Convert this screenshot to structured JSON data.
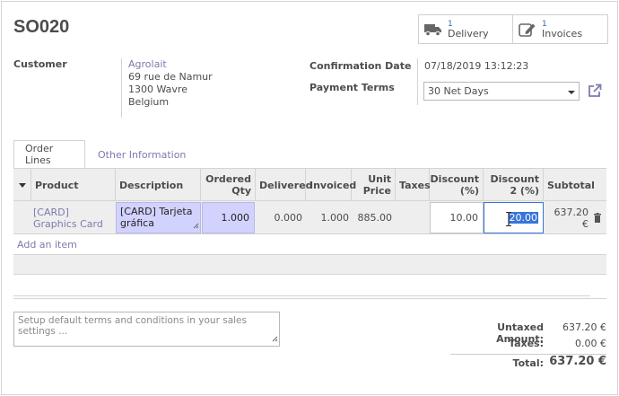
{
  "header": {
    "title": "SO020",
    "smart_buttons": [
      {
        "count": "1",
        "label": "Delivery",
        "icon": "truck-icon"
      },
      {
        "count": "1",
        "label": "Invoices",
        "icon": "pencil-square-icon"
      }
    ]
  },
  "customer": {
    "label": "Customer",
    "name": "Agrolait",
    "address_line1": "69 rue de Namur",
    "address_line2": "1300 Wavre",
    "country": "Belgium"
  },
  "confirmation": {
    "label": "Confirmation Date",
    "value": "07/18/2019 13:12:23"
  },
  "payment_terms": {
    "label": "Payment Terms",
    "value": "30 Net Days"
  },
  "tabs": [
    {
      "label": "Order Lines"
    },
    {
      "label": "Other Information"
    }
  ],
  "table": {
    "columns": {
      "product": "Product",
      "description": "Description",
      "ordered_qty": "Ordered Qty",
      "delivered": "Delivered",
      "invoiced": "Invoiced",
      "unit_price": "Unit Price",
      "taxes": "Taxes",
      "discount": "Discount (%)",
      "discount2": "Discount 2 (%)",
      "subtotal": "Subtotal"
    },
    "row": {
      "product": "[CARD] Graphics Card",
      "description": "[CARD] Tarjeta gráfica",
      "ordered_qty": "1.000",
      "delivered": "0.000",
      "invoiced": "1.000",
      "unit_price": "885.00",
      "taxes": "",
      "discount": "10.00",
      "discount2": "20.00",
      "subtotal": "637.20 €"
    },
    "add_item": "Add an item"
  },
  "terms_note": {
    "placeholder": "Setup default terms and conditions in your sales settings ..."
  },
  "totals": {
    "untaxed_label": "Untaxed Amount:",
    "untaxed_value": "637.20 €",
    "taxes_label": "Taxes:",
    "taxes_value": "0.00 €",
    "total_label": "Total:",
    "total_value": "637.20 €"
  },
  "colors": {
    "link": "#7c7bad",
    "edited_cell": "#d2d2ff",
    "selection": "#3875d7"
  }
}
